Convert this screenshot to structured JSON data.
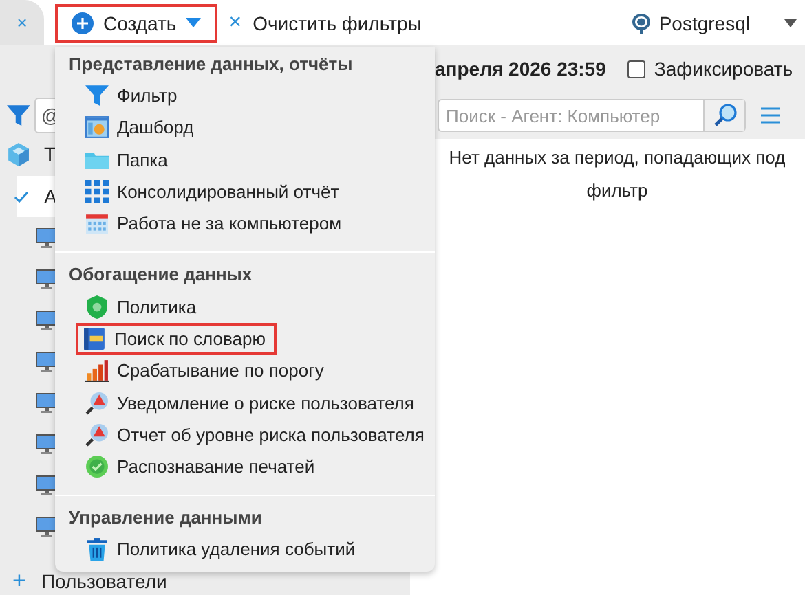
{
  "toolbar": {
    "close": "×",
    "create_button": {
      "label": "Создать",
      "highlighted": true
    },
    "clear_filters": {
      "icon": "×",
      "label": "Очистить фильтры"
    },
    "database": {
      "label": "Postgresql"
    }
  },
  "sidebar": {
    "filter_field": {
      "value": "@"
    },
    "rows": [
      {
        "kind": "group",
        "label": "Т"
      },
      {
        "kind": "check",
        "label": "А",
        "selected": true
      },
      {
        "kind": "computer",
        "selected": false
      },
      {
        "kind": "computer",
        "selected": false
      },
      {
        "kind": "computer",
        "selected": false
      },
      {
        "kind": "computer",
        "selected": false
      },
      {
        "kind": "computer",
        "selected": false
      },
      {
        "kind": "computer",
        "selected": false
      },
      {
        "kind": "computer",
        "selected": false
      },
      {
        "kind": "computer",
        "selected": false
      }
    ],
    "footer": {
      "icon": "+",
      "label": "Пользователи"
    }
  },
  "period": {
    "date": "апреля 2026 23:59",
    "fix_checkbox": {
      "label": "Зафиксировать",
      "checked": false
    }
  },
  "search": {
    "placeholder": "Поиск - Агент: Компьютер"
  },
  "message": "Нет данных за период, попадающих под фильтр",
  "menu": {
    "sections": [
      {
        "title": "Представление данных, отчёты",
        "items": [
          {
            "kind": "filter",
            "label": "Фильтр",
            "highlighted": false
          },
          {
            "kind": "dashboard",
            "label": "Дашборд",
            "highlighted": false
          },
          {
            "kind": "folder",
            "label": "Папка",
            "highlighted": false
          },
          {
            "kind": "grid",
            "label": "Консолидированный отчёт",
            "highlighted": false
          },
          {
            "kind": "calendar",
            "label": "Работа не за компьютером",
            "highlighted": false
          }
        ]
      },
      {
        "title": "Обогащение данных",
        "items": [
          {
            "kind": "shield",
            "label": "Политика",
            "highlighted": false
          },
          {
            "kind": "book",
            "label": "Поиск по словарю",
            "highlighted": true
          },
          {
            "kind": "bars",
            "label": "Срабатывание по порогу",
            "highlighted": false
          },
          {
            "kind": "risk",
            "label": "Уведомление о риске пользователя",
            "highlighted": false
          },
          {
            "kind": "risk",
            "label": "Отчет об уровне риска пользователя",
            "highlighted": false
          },
          {
            "kind": "stamp",
            "label": "Распознавание печатей",
            "highlighted": false
          }
        ]
      },
      {
        "title": "Управление данными",
        "items": [
          {
            "kind": "trash",
            "label": "Политика удаления событий",
            "highlighted": false
          }
        ]
      }
    ]
  }
}
